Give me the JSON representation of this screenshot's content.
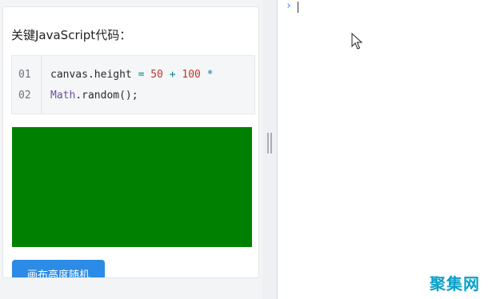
{
  "demo": {
    "heading": "关键JavaScript代码：",
    "code": {
      "line_numbers": [
        "01",
        "02"
      ],
      "line1": {
        "prefix": "canvas.height ",
        "op1": "=",
        "num1": "50",
        "op2": "+",
        "num2": "100",
        "op3": "*"
      },
      "line2": {
        "obj": "Math",
        "rest": ".random();"
      }
    },
    "canvas_color": "#008000",
    "button_label": "画布高度随机"
  },
  "console": {
    "prompt_icon": "chevron-right-icon"
  },
  "watermark": "聚集网"
}
